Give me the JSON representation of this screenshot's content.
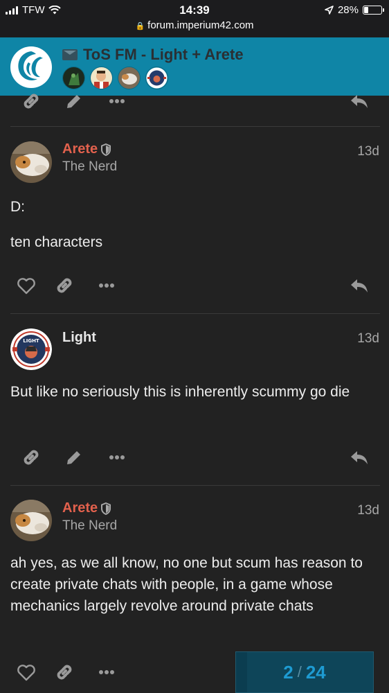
{
  "status_bar": {
    "carrier": "TFW",
    "time": "14:39",
    "battery": "28%",
    "battery_level": 0.28,
    "url": "forum.imperium42.com"
  },
  "header": {
    "topic_title": "ToS FM - Light + Arete",
    "accent_color": "#0f85a6"
  },
  "posts": [
    {
      "username": "Arete",
      "user_title": "The Nerd",
      "date": "13d",
      "paragraphs": [
        "D:",
        "ten characters"
      ],
      "actions": [
        "like-icon",
        "link-icon",
        "more-icon",
        "reply-icon"
      ]
    },
    {
      "username": "Light",
      "user_title": "",
      "date": "13d",
      "paragraphs": [
        "But like no seriously this is inherently scummy go die"
      ],
      "actions": [
        "link-icon",
        "edit-icon",
        "more-icon",
        "reply-icon"
      ]
    },
    {
      "username": "Arete",
      "user_title": "The Nerd",
      "date": "13d",
      "paragraphs": [
        "ah yes, as we all know, no one but scum has reason to create private chats with people, in a game whose mechanics largely revolve around private chats"
      ],
      "actions": [
        "like-icon",
        "link-icon",
        "more-icon"
      ]
    }
  ],
  "progress": {
    "current": "2",
    "total": "24",
    "fraction": 0.083
  }
}
